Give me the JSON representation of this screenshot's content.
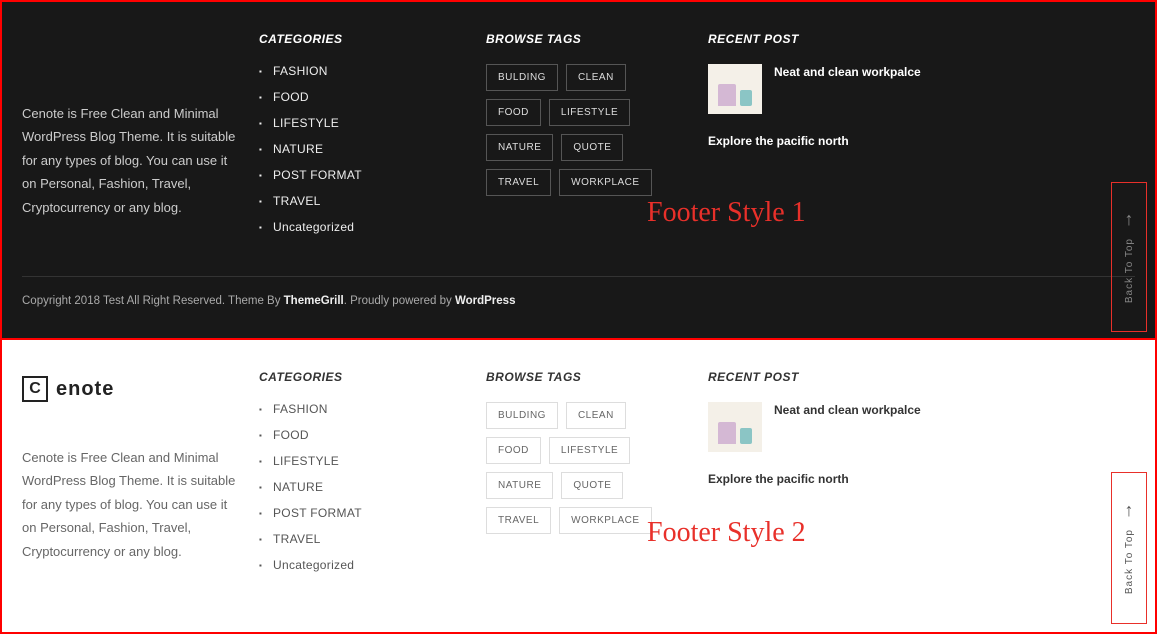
{
  "annotations": {
    "style1": "Footer Style 1",
    "style2": "Footer Style 2"
  },
  "logo": {
    "letter": "C",
    "name": "enote"
  },
  "about": {
    "text": "Cenote is Free Clean and Minimal WordPress Blog Theme. It is suitable for any types of blog. You can use it on Personal, Fashion, Travel, Cryptocurrency  or any blog."
  },
  "categories": {
    "title": "CATEGORIES",
    "items": [
      "FASHION",
      "FOOD",
      "LIFESTYLE",
      "NATURE",
      "POST FORMAT",
      "TRAVEL",
      "Uncategorized"
    ]
  },
  "tags": {
    "title": "BROWSE TAGS",
    "items": [
      "BULDING",
      "CLEAN",
      "FOOD",
      "LIFESTYLE",
      "NATURE",
      "QUOTE",
      "TRAVEL",
      "WORKPLACE"
    ]
  },
  "recent": {
    "title": "RECENT POST",
    "post1": "Neat and clean workpalce",
    "post2": "Explore the pacific north"
  },
  "copyright": {
    "pre": "Copyright 2018 Test All Right Reserved. Theme By ",
    "tg": "ThemeGrill",
    "mid": ". Proudly powered by ",
    "wp": "WordPress"
  },
  "back_to_top": "Back To Top"
}
